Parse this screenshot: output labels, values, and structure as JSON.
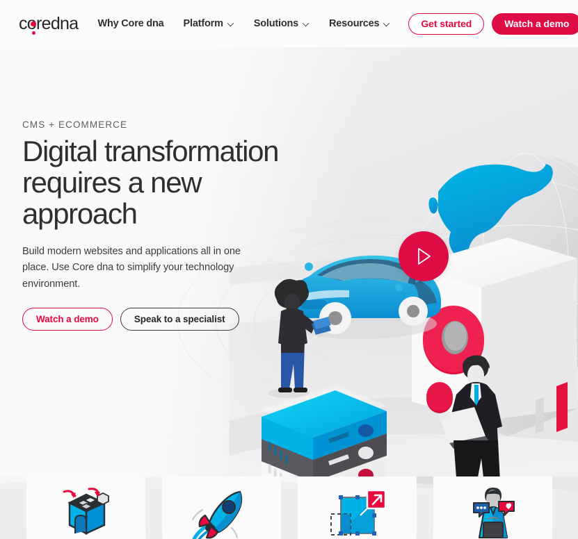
{
  "brand": {
    "logo_text": "coredna",
    "accent_pink": "#e8083e",
    "accent_crimson": "#dd0c44",
    "accent_cyan": "#00a9e0",
    "ink": "#2e2f33"
  },
  "header": {
    "logo_name": "core dna logo",
    "nav": [
      {
        "label": "Why Core dna",
        "has_chevron": false,
        "name": "nav-why-core-dna"
      },
      {
        "label": "Platform",
        "has_chevron": true,
        "name": "nav-platform"
      },
      {
        "label": "Solutions",
        "has_chevron": true,
        "name": "nav-solutions"
      },
      {
        "label": "Resources",
        "has_chevron": true,
        "name": "nav-resources"
      }
    ],
    "cta_secondary": "Get started",
    "cta_primary": "Watch a demo"
  },
  "hero": {
    "eyebrow": "CMS + ECOMMERCE",
    "headline_line1": "Digital transformation",
    "headline_line2": "requires a new",
    "headline_line3": "approach",
    "subcopy": "Build modern websites and applications all in one place. Use Core dna to simplify your technology environment.",
    "btn_demo": "Watch a demo",
    "btn_specialist": "Speak to a specialist",
    "play_button_label": "play-video"
  },
  "illustration": {
    "alt": "isometric digital transformation scene",
    "elements": [
      "globe",
      "white-box-with-red-lens",
      "blue-car",
      "woman-with-tablet",
      "businessman-with-laptop",
      "server-stack",
      "concentric-rings"
    ]
  },
  "cards": [
    {
      "icon": "crate-box-icon",
      "name": "card-modular"
    },
    {
      "icon": "rocket-icon",
      "name": "card-launch"
    },
    {
      "icon": "resize-artboard-icon",
      "name": "card-design"
    },
    {
      "icon": "support-person-icon",
      "name": "card-support"
    }
  ]
}
